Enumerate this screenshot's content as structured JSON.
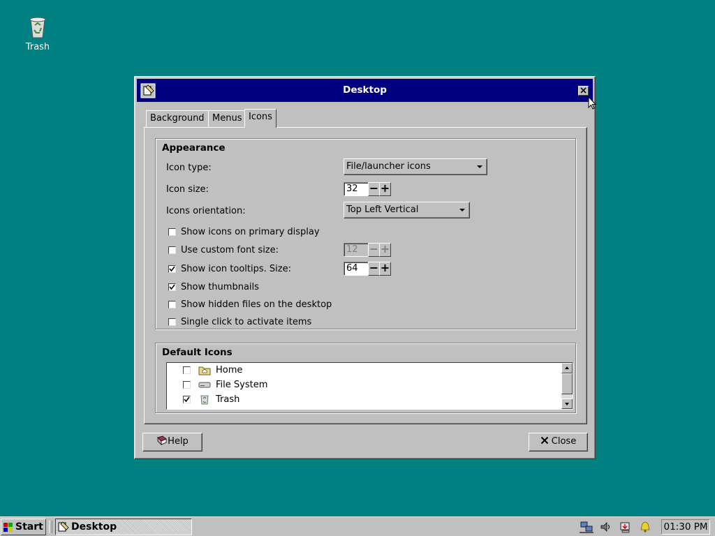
{
  "desktop": {
    "trash_label": "Trash"
  },
  "window": {
    "title": "Desktop",
    "tabs": [
      {
        "label": "Background",
        "active": false
      },
      {
        "label": "Menus",
        "active": false
      },
      {
        "label": "Icons",
        "active": true
      }
    ],
    "appearance": {
      "title": "Appearance",
      "icon_type_label": "Icon type:",
      "icon_type_value": "File/launcher icons",
      "icon_size_label": "Icon size:",
      "icon_size_value": "32",
      "orientation_label": "Icons orientation:",
      "orientation_value": "Top Left Vertical",
      "checks": {
        "primary_display": {
          "label": "Show icons on primary display",
          "checked": false
        },
        "custom_font": {
          "label": "Use custom font size:",
          "checked": false,
          "value": "12",
          "disabled": true
        },
        "tooltips": {
          "label": "Show icon tooltips. Size:",
          "checked": true,
          "value": "64"
        },
        "thumbnails": {
          "label": "Show thumbnails",
          "checked": true
        },
        "hidden_files": {
          "label": "Show hidden files on the desktop",
          "checked": false
        },
        "single_click": {
          "label": "Single click to activate items",
          "checked": false
        }
      }
    },
    "default_icons": {
      "title": "Default Icons",
      "items": [
        {
          "label": "Home",
          "checked": false,
          "icon": "home-folder-icon"
        },
        {
          "label": "File System",
          "checked": false,
          "icon": "drive-icon"
        },
        {
          "label": "Trash",
          "checked": true,
          "icon": "trash-icon"
        }
      ]
    },
    "buttons": {
      "help": "Help",
      "close": "Close"
    }
  },
  "taskbar": {
    "start_label": "Start",
    "task_label": "Desktop",
    "clock": "01:30 PM",
    "tray_icons": [
      "network-icon",
      "volume-icon",
      "updates-icon",
      "notification-bell-icon"
    ]
  }
}
